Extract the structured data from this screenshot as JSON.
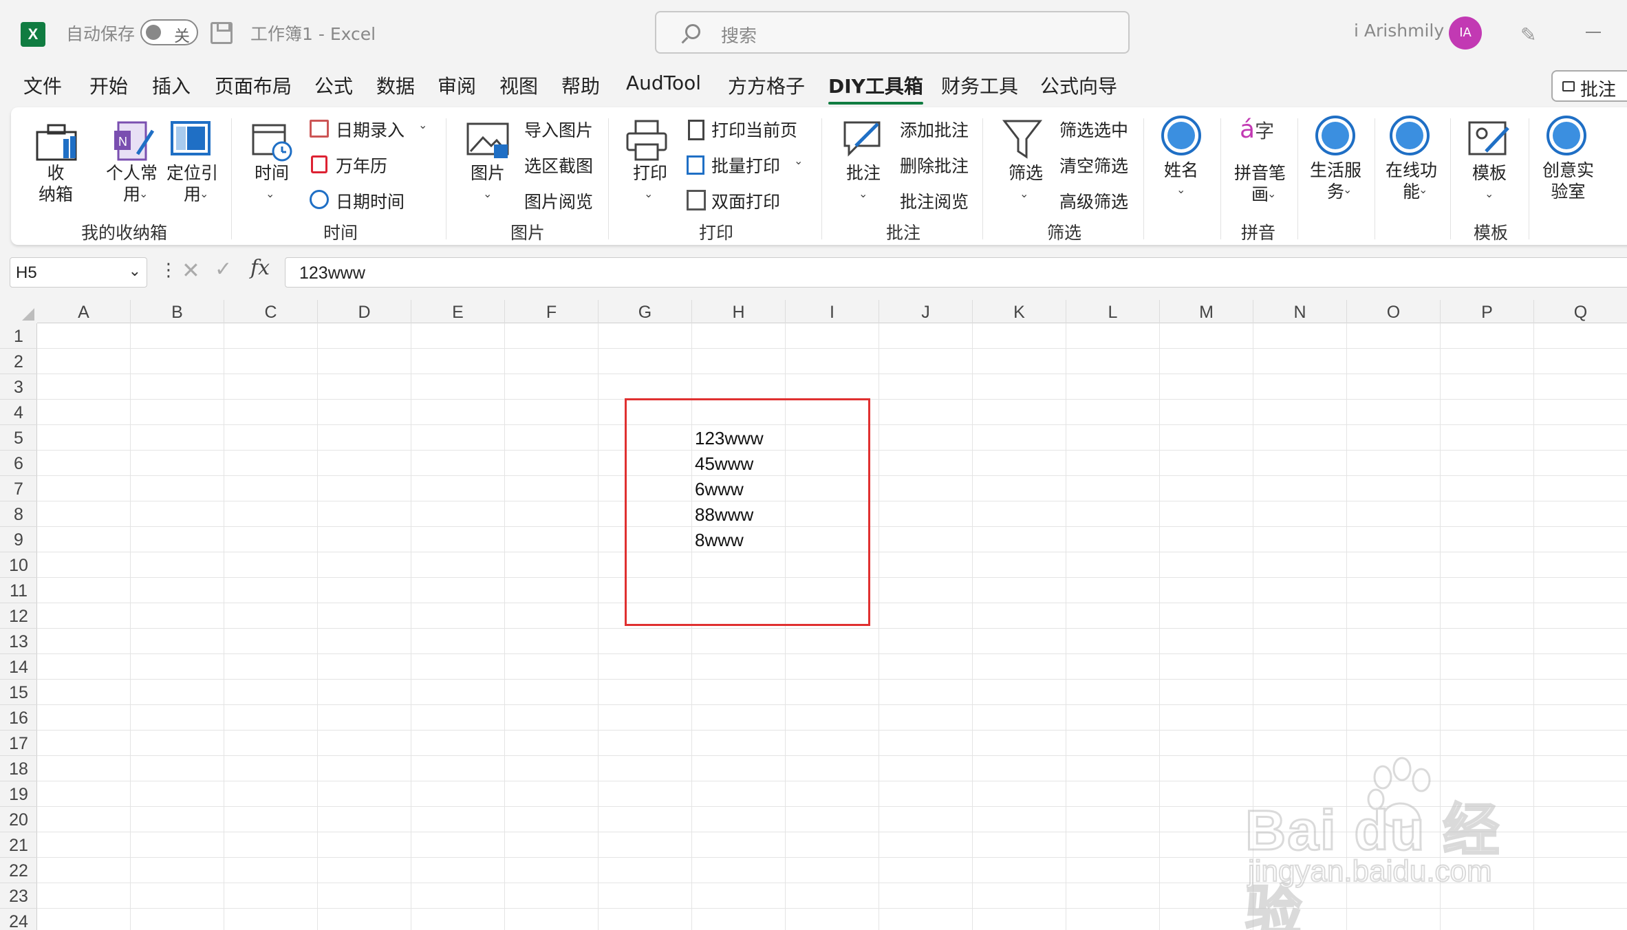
{
  "titlebar": {
    "autosave_label": "自动保存",
    "autosave_state": "关",
    "doc_title": "工作簿1  -  Excel",
    "search_placeholder": "搜索",
    "user_name": "i Arishmily",
    "avatar_initials": "IA"
  },
  "menu": {
    "items": [
      "文件",
      "开始",
      "插入",
      "页面布局",
      "公式",
      "数据",
      "审阅",
      "视图",
      "帮助",
      "AudTool",
      "方方格子",
      "DIY工具箱",
      "财务工具",
      "公式向导"
    ],
    "active": "DIY工具箱",
    "comment_button": "批注"
  },
  "ribbon": {
    "groups": {
      "storage": {
        "title": "我的收纳箱",
        "shounaxiang": "收\n纳箱",
        "geren": "个人常\n用",
        "dingwei": "定位引\n用"
      },
      "time": {
        "title": "时间",
        "shijian": "时间",
        "riqiluru": "日期录入",
        "wannianli": "万年历",
        "riqishijian": "日期时间"
      },
      "picture": {
        "title": "图片",
        "tupian": "图片",
        "daorutupian": "导入图片",
        "xuanqujietu": "选区截图",
        "tupianyuelan": "图片阅览"
      },
      "print": {
        "title": "打印",
        "dayin": "打印",
        "dayindangqianye": "打印当前页",
        "piliangdayin": "批量打印",
        "shuangmiandayin": "双面打印"
      },
      "comment": {
        "title": "批注",
        "pizhu": "批注",
        "tianjia": "添加批注",
        "shanchu": "删除批注",
        "yuelan": "批注阅览"
      },
      "filter": {
        "title": "筛选",
        "shaixuan": "筛选",
        "shaixuanxuanzhong": "筛选选中",
        "qingkong": "清空筛选",
        "gaoji": "高级筛选"
      },
      "name": {
        "xingming": "姓名"
      },
      "pinyin": {
        "title": "拼音",
        "pinyinbihua": "拼音笔\n画"
      },
      "life": {
        "shenghuo": "生活服\n务"
      },
      "online": {
        "zaixian": "在线功\n能"
      },
      "template": {
        "title": "模板",
        "muban": "模板"
      },
      "lab": {
        "chuangyi": "创意实\n验室"
      }
    }
  },
  "formula_bar": {
    "name_box": "H5",
    "formula": "123www"
  },
  "sheet": {
    "columns": [
      "A",
      "B",
      "C",
      "D",
      "E",
      "F",
      "G",
      "H",
      "I",
      "J",
      "K",
      "L",
      "M",
      "N",
      "O",
      "P",
      "Q"
    ],
    "rows": [
      "1",
      "2",
      "3",
      "4",
      "5",
      "6",
      "7",
      "8",
      "9",
      "10",
      "11",
      "12",
      "13",
      "14",
      "15",
      "16",
      "17",
      "18",
      "19",
      "20",
      "21",
      "22",
      "23",
      "24"
    ],
    "cells_H": [
      {
        "row": "5",
        "value": "123www"
      },
      {
        "row": "6",
        "value": "45www"
      },
      {
        "row": "7",
        "value": "6www"
      },
      {
        "row": "8",
        "value": "88www"
      },
      {
        "row": "9",
        "value": "8www"
      }
    ]
  },
  "watermark": {
    "brand": "Bai du 经验",
    "url": "jingyan.baidu.com"
  },
  "colors": {
    "excel_green": "#107c41",
    "highlight_red": "#e03030",
    "accent_blue": "#1f6fc5",
    "avatar": "#c239b3"
  }
}
